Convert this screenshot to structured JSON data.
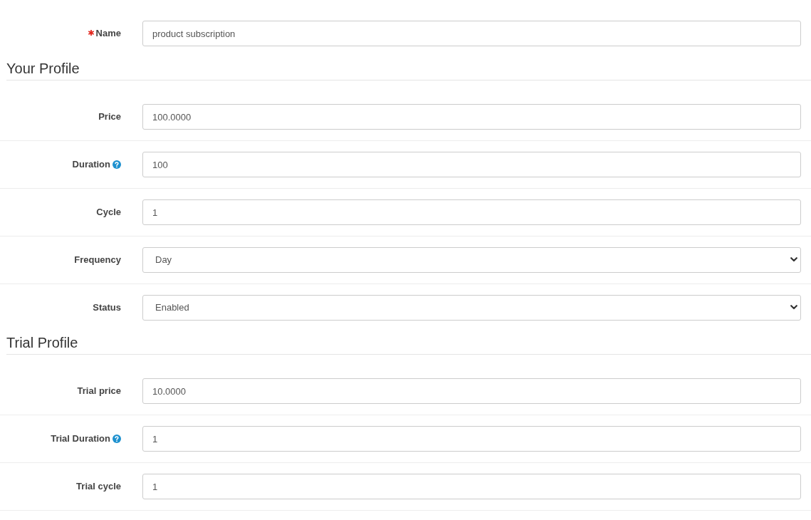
{
  "name_field": {
    "label": "Name",
    "required": true,
    "value": "product subscription"
  },
  "sections": [
    {
      "title": "Your Profile",
      "fields": [
        {
          "kind": "text",
          "label": "Price",
          "help": false,
          "value": "100.0000"
        },
        {
          "kind": "text",
          "label": "Duration",
          "help": true,
          "value": "100"
        },
        {
          "kind": "text",
          "label": "Cycle",
          "help": false,
          "value": "1"
        },
        {
          "kind": "select",
          "label": "Frequency",
          "help": false,
          "value": "Day"
        },
        {
          "kind": "select",
          "label": "Status",
          "help": false,
          "value": "Enabled"
        }
      ]
    },
    {
      "title": "Trial Profile",
      "fields": [
        {
          "kind": "text",
          "label": "Trial price",
          "help": false,
          "value": "10.0000"
        },
        {
          "kind": "text",
          "label": "Trial Duration",
          "help": true,
          "value": "1"
        },
        {
          "kind": "text",
          "label": "Trial cycle",
          "help": false,
          "value": "1"
        }
      ]
    }
  ]
}
